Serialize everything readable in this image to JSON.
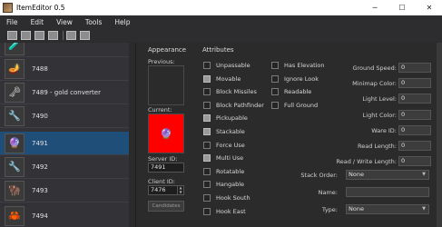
{
  "window": {
    "title": "ItemEditor 0.5",
    "minimize": "─",
    "maximize": "☐",
    "close": "✕"
  },
  "menu": [
    "File",
    "Edit",
    "View",
    "Tools",
    "Help"
  ],
  "items": [
    {
      "id": "",
      "label": "",
      "icon": "item-sprite-icon",
      "glyph": "🧪",
      "selected": false
    },
    {
      "id": "7488",
      "label": "7488",
      "icon": "item-sprite-icon",
      "glyph": "🪔",
      "selected": false
    },
    {
      "id": "7489",
      "label": "7489 - gold converter",
      "icon": "item-sprite-icon",
      "glyph": "🗝",
      "selected": false
    },
    {
      "id": "7490",
      "label": "7490",
      "icon": "item-sprite-icon",
      "glyph": "🔧",
      "selected": false
    },
    {
      "id": "7491",
      "label": "7491",
      "icon": "item-sprite-icon",
      "glyph": "🔮",
      "selected": true
    },
    {
      "id": "7492",
      "label": "7492",
      "icon": "item-sprite-icon",
      "glyph": "🔧",
      "selected": false
    },
    {
      "id": "7493",
      "label": "7493",
      "icon": "item-sprite-icon",
      "glyph": "🦬",
      "selected": false
    },
    {
      "id": "7494",
      "label": "7494",
      "icon": "item-sprite-icon",
      "glyph": "🦀",
      "selected": false
    }
  ],
  "appearance": {
    "title": "Appearance",
    "previous_label": "Previous:",
    "current_label": "Current:",
    "server_id_label": "Server ID:",
    "server_id": "7491",
    "client_id_label": "Client ID:",
    "client_id": "7476",
    "candidates_button": "Candidates",
    "current_bg": "#ff0000"
  },
  "attributes": {
    "title": "Attributes",
    "left_checkboxes": [
      {
        "label": "Unpassable",
        "checked": false
      },
      {
        "label": "Movable",
        "checked": true
      },
      {
        "label": "Block Missiles",
        "checked": false
      },
      {
        "label": "Block Pathfinder",
        "checked": false
      },
      {
        "label": "Pickupable",
        "checked": true
      },
      {
        "label": "Stackable",
        "checked": true
      },
      {
        "label": "Force Use",
        "checked": false
      },
      {
        "label": "Multi Use",
        "checked": true
      },
      {
        "label": "Rotatable",
        "checked": false
      },
      {
        "label": "Hangable",
        "checked": false
      },
      {
        "label": "Hook South",
        "checked": false
      },
      {
        "label": "Hook East",
        "checked": false
      }
    ],
    "right_checkboxes": [
      {
        "label": "Has Elevation",
        "checked": false
      },
      {
        "label": "Ignore Look",
        "checked": false
      },
      {
        "label": "Readable",
        "checked": false
      },
      {
        "label": "Full Ground",
        "checked": false
      }
    ],
    "fields": [
      {
        "label": "Ground Speed:",
        "value": "0"
      },
      {
        "label": "Minimap Color:",
        "value": "0"
      },
      {
        "label": "Light Level:",
        "value": "0"
      },
      {
        "label": "Light Color:",
        "value": "0"
      },
      {
        "label": "Ware ID:",
        "value": "0"
      },
      {
        "label": "Read Length:",
        "value": "0"
      },
      {
        "label": "Read / Write Length:",
        "value": "0"
      }
    ],
    "stack_order_label": "Stack Order:",
    "stack_order_value": "None",
    "name_label": "Name:",
    "name_value": "",
    "type_label": "Type:",
    "type_value": "None"
  }
}
